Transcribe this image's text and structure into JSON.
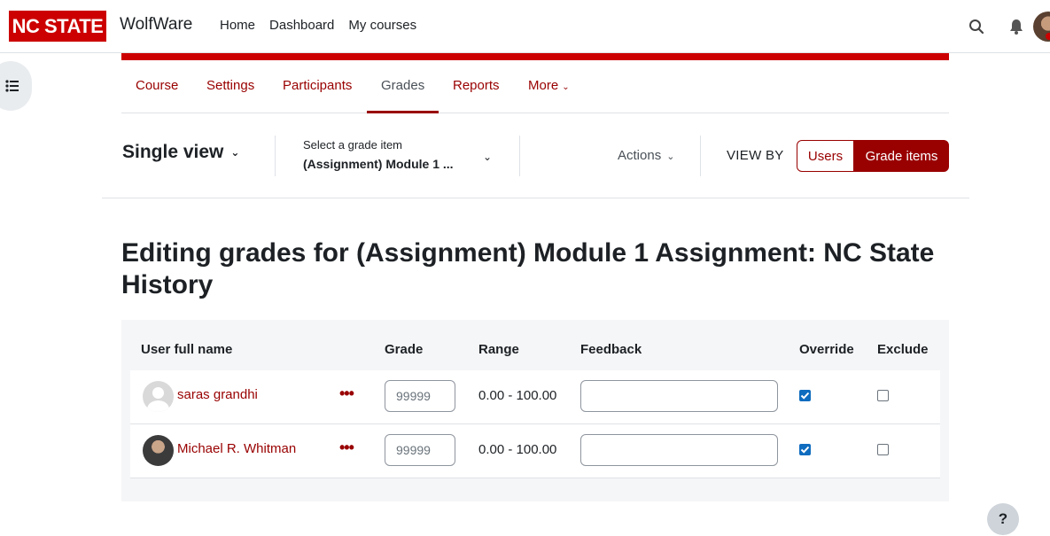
{
  "brand": {
    "logo_text": "NC STATE",
    "site_name": "WolfWare",
    "logo_color": "#cc0000"
  },
  "topnav": {
    "items": [
      "Home",
      "Dashboard",
      "My courses"
    ]
  },
  "nav_icons": [
    "search-icon",
    "bell-icon",
    "message-icon",
    "user-avatar"
  ],
  "secondary_nav": {
    "tabs": [
      {
        "label": "Course"
      },
      {
        "label": "Settings"
      },
      {
        "label": "Participants"
      },
      {
        "label": "Grades",
        "active": true
      },
      {
        "label": "Reports"
      },
      {
        "label": "More"
      }
    ]
  },
  "tertiary": {
    "report_selector": "Single view",
    "grade_item_label": "Select a grade item",
    "grade_item_value": "(Assignment) Module 1 ...",
    "actions_label": "Actions",
    "view_by_label": "VIEW BY",
    "view_by_options": [
      "Users",
      "Grade items"
    ],
    "view_by_selected": "Grade items"
  },
  "page": {
    "heading": "Editing grades for (Assignment) Module 1 Assignment: NC State History"
  },
  "table": {
    "headers": {
      "user": "User full name",
      "grade": "Grade",
      "range": "Range",
      "feedback": "Feedback",
      "override": "Override",
      "exclude": "Exclude"
    },
    "rows": [
      {
        "name": "saras grandhi",
        "grade_placeholder": "99999",
        "range": "0.00 - 100.00",
        "feedback": "",
        "override": true,
        "exclude": false
      },
      {
        "name": "Michael R. Whitman",
        "grade_placeholder": "99999",
        "range": "0.00 - 100.00",
        "feedback": "",
        "override": true,
        "exclude": false
      }
    ]
  },
  "help_label": "?",
  "colors": {
    "accent": "#990000",
    "brand_red": "#cc0000",
    "checkbox_blue": "#0f6cbf"
  }
}
